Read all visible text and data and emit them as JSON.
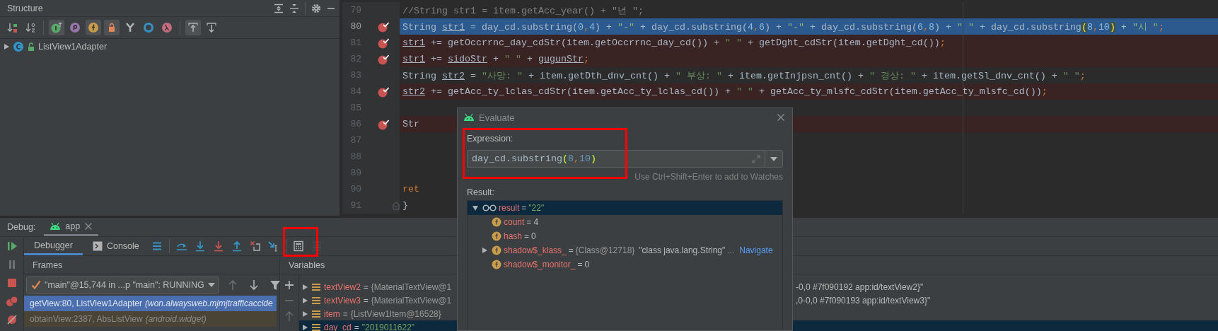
{
  "structure_panel": {
    "title": "Structure",
    "header_tools": [
      {
        "kind": "expand-all"
      },
      {
        "kind": "collapse-all"
      },
      {
        "kind": "gear"
      },
      {
        "kind": "minimize"
      }
    ],
    "toolbar": [
      {
        "kind": "sort-visibility",
        "on": false
      },
      {
        "kind": "sort-alpha",
        "on": false
      },
      {
        "kind": "inherited",
        "on": true
      },
      {
        "kind": "property",
        "on": false
      },
      {
        "kind": "field",
        "on": true
      },
      {
        "kind": "non-public",
        "on": true
      },
      {
        "kind": "anonymous",
        "on": false
      },
      {
        "kind": "circle",
        "on": false
      },
      {
        "kind": "lambda",
        "on": false
      },
      {
        "kind": "scroll-to",
        "on": true
      },
      {
        "kind": "scroll-from",
        "on": false
      }
    ],
    "tree": [
      {
        "label": "ListView1Adapter",
        "expanded": false
      }
    ]
  },
  "editor": {
    "lines": [
      {
        "number": "79",
        "breakpoint": false,
        "current": false,
        "tokens": [
          {
            "kind": "comment",
            "text": "       //String str1 = item.getAcc_year() + \"년 \";"
          }
        ]
      },
      {
        "number": "80",
        "breakpoint": true,
        "current": true,
        "tokens": [
          {
            "kind": "plain",
            "text": "       String "
          },
          {
            "kind": "var",
            "text": "str1"
          },
          {
            "kind": "plain",
            "text": " = day_cd.substring("
          },
          {
            "kind": "number",
            "text": "0"
          },
          {
            "kind": "punct",
            "text": ","
          },
          {
            "kind": "number",
            "text": "4"
          },
          {
            "kind": "plain",
            "text": ") + "
          },
          {
            "kind": "string",
            "text": "\"-\""
          },
          {
            "kind": "plain",
            "text": " + day_cd.substring("
          },
          {
            "kind": "number",
            "text": "4"
          },
          {
            "kind": "punct",
            "text": ","
          },
          {
            "kind": "number",
            "text": "6"
          },
          {
            "kind": "plain",
            "text": ") + "
          },
          {
            "kind": "string",
            "text": "\"-\""
          },
          {
            "kind": "plain",
            "text": " + day_cd.substring("
          },
          {
            "kind": "number",
            "text": "6"
          },
          {
            "kind": "punct",
            "text": ","
          },
          {
            "kind": "number",
            "text": "8"
          },
          {
            "kind": "plain",
            "text": ") + "
          },
          {
            "kind": "string",
            "text": "\" \""
          },
          {
            "kind": "plain",
            "text": " + day_cd.substring"
          },
          {
            "kind": "brace",
            "text": "("
          },
          {
            "kind": "number",
            "text": "8"
          },
          {
            "kind": "punct",
            "text": ","
          },
          {
            "kind": "number",
            "text": "10"
          },
          {
            "kind": "brace",
            "text": ")"
          },
          {
            "kind": "plain",
            "text": " + "
          },
          {
            "kind": "string",
            "text": "\"시 \""
          },
          {
            "kind": "punct",
            "text": ";"
          }
        ]
      },
      {
        "number": "81",
        "breakpoint": true,
        "current": false,
        "tokens": [
          {
            "kind": "var",
            "text": "              str1"
          },
          {
            "kind": "plain",
            "text": " += getOccrrnc_day_cdStr(item.getOccrrnc_day_cd()) + "
          },
          {
            "kind": "string",
            "text": "\" \""
          },
          {
            "kind": "plain",
            "text": " + getDght_cdStr(item.getDght_cd())"
          },
          {
            "kind": "punct",
            "text": ";"
          }
        ]
      },
      {
        "number": "82",
        "breakpoint": true,
        "current": false,
        "tokens": [
          {
            "kind": "var",
            "text": "              str1"
          },
          {
            "kind": "plain",
            "text": " += "
          },
          {
            "kind": "var",
            "text": "sidoStr"
          },
          {
            "kind": "plain",
            "text": " + "
          },
          {
            "kind": "string",
            "text": "\" \""
          },
          {
            "kind": "plain",
            "text": " + "
          },
          {
            "kind": "var",
            "text": "gugunStr"
          },
          {
            "kind": "punct",
            "text": ";"
          }
        ]
      },
      {
        "number": "83",
        "breakpoint": false,
        "current": false,
        "tokens": [
          {
            "kind": "plain",
            "text": "       String "
          },
          {
            "kind": "var",
            "text": "str2"
          },
          {
            "kind": "plain",
            "text": " = "
          },
          {
            "kind": "string",
            "text": "\"사망: \""
          },
          {
            "kind": "plain",
            "text": " + item.getDth_dnv_cnt() + "
          },
          {
            "kind": "string",
            "text": "\" 부상: \""
          },
          {
            "kind": "plain",
            "text": " + item.getInjpsn_cnt() + "
          },
          {
            "kind": "string",
            "text": "\" 경상: \""
          },
          {
            "kind": "plain",
            "text": " + item.getSl_dnv_cnt() + "
          },
          {
            "kind": "string",
            "text": "\" \""
          },
          {
            "kind": "punct",
            "text": ";"
          }
        ]
      },
      {
        "number": "84",
        "breakpoint": true,
        "current": false,
        "tokens": [
          {
            "kind": "var",
            "text": "              str2"
          },
          {
            "kind": "plain",
            "text": " += getAcc_ty_lclas_cdStr(item.getAcc_ty_lclas_cd()) + "
          },
          {
            "kind": "string",
            "text": "\" \""
          },
          {
            "kind": "plain",
            "text": " + getAcc_ty_mlsfc_cdStr(item.getAcc_ty_mlsfc_cd())"
          },
          {
            "kind": "punct",
            "text": ";"
          }
        ]
      },
      {
        "number": "85",
        "breakpoint": false,
        "current": false
      },
      {
        "number": "86",
        "breakpoint": true,
        "current": false,
        "tokens": [
          {
            "kind": "plain",
            "text": "       Str"
          }
        ]
      },
      {
        "number": "87",
        "breakpoint": false,
        "current": false
      },
      {
        "number": "88",
        "breakpoint": false,
        "current": false
      },
      {
        "number": "89",
        "breakpoint": false,
        "current": false
      },
      {
        "number": "90",
        "breakpoint": false,
        "current": false,
        "tokens": [
          {
            "kind": "keyword",
            "text": "       ret"
          }
        ]
      },
      {
        "number": "91",
        "breakpoint": false,
        "current": false,
        "fold": true,
        "tokens": [
          {
            "kind": "plain",
            "text": "   }"
          }
        ]
      }
    ]
  },
  "debug": {
    "label": "Debug:",
    "session_tab": {
      "label": "app",
      "selected": true
    },
    "side_tools": [
      {
        "kind": "resume",
        "disabled": false
      },
      {
        "kind": "pause",
        "disabled": true
      },
      {
        "kind": "stop",
        "disabled": false
      },
      {
        "kind": "breakpoints",
        "disabled": false
      },
      {
        "kind": "mute",
        "disabled": false
      }
    ],
    "tabs": [
      {
        "label": "Debugger",
        "selected": true,
        "kind": "plain"
      },
      {
        "label": "Console",
        "selected": false,
        "kind": "console"
      }
    ],
    "tools": [
      {
        "kind": "menu",
        "disabled": false
      },
      {
        "kind": "separator"
      },
      {
        "kind": "exec-point",
        "disabled": false
      },
      {
        "kind": "step-into",
        "disabled": false
      },
      {
        "kind": "force-step-into",
        "disabled": false
      },
      {
        "kind": "step-out",
        "disabled": false
      },
      {
        "kind": "drop-frame",
        "disabled": false
      },
      {
        "kind": "run-cursor",
        "disabled": false
      },
      {
        "kind": "separator"
      },
      {
        "kind": "calculator",
        "disabled": false,
        "annotated": true
      },
      {
        "kind": "trace",
        "disabled": true
      }
    ],
    "frames": {
      "title": "Frames",
      "thread": "\"main\"@15,744 in ...p \"main\": RUNNING",
      "nav": [
        {
          "kind": "up",
          "disabled": true
        },
        {
          "kind": "down",
          "disabled": false
        },
        {
          "kind": "filter",
          "disabled": false
        }
      ],
      "rows": [
        {
          "method": "getView:80, ListView1Adapter",
          "package": "(won.alwaysweb.mjmjtrafficaccide",
          "selected": true,
          "kind": "app"
        },
        {
          "method": "obtainView:2387, AbsListView",
          "package": "(android.widget)",
          "selected": false,
          "kind": "library"
        }
      ]
    },
    "variables": {
      "title": "Variables",
      "tools": [
        {
          "kind": "plus",
          "disabled": false
        },
        {
          "kind": "minus",
          "disabled": true
        },
        {
          "kind": "up",
          "disabled": true
        }
      ],
      "rows": [
        {
          "name": "textView2",
          "op": "=",
          "value": "{MaterialTextView@1",
          "tail": "-0,0 #7f090192 app:id/textView2}\"",
          "kind": "object",
          "selected": false
        },
        {
          "name": "textView3",
          "op": "=",
          "value": "{MaterialTextView@1",
          "tail": ",0-0,0 #7f090193 app:id/textView3}\"",
          "kind": "object",
          "selected": false
        },
        {
          "name": "item",
          "op": "=",
          "value": "{ListView1Item@16528}",
          "kind": "object",
          "selected": false
        },
        {
          "name": "day_cd",
          "op": "=",
          "value": "\"2019011622\"",
          "kind": "string",
          "selected": true
        }
      ]
    }
  },
  "evaluate_dialog": {
    "title": "Evaluate",
    "expression_label": "Expression:",
    "annotated": true,
    "expression": [
      {
        "kind": "plain",
        "text": "day_cd.substring"
      },
      {
        "kind": "brace",
        "text": "("
      },
      {
        "kind": "number",
        "text": "8"
      },
      {
        "kind": "punct",
        "text": ","
      },
      {
        "kind": "number",
        "text": "10"
      },
      {
        "kind": "brace",
        "text": ")"
      }
    ],
    "hint": "Use Ctrl+Shift+Enter to add to Watches",
    "result_label": "Result:",
    "result": {
      "name": "result",
      "op": "=",
      "value": "\"22\"",
      "kind": "string",
      "expanded": true,
      "selected": true,
      "children": [
        {
          "name": "count",
          "op": "=",
          "value": "4",
          "kind": "plain",
          "has_children": false
        },
        {
          "name": "hash",
          "op": "=",
          "value": "0",
          "kind": "plain",
          "has_children": false
        },
        {
          "name": "shadow$_klass_",
          "op": "=",
          "value": "{Class@12718}",
          "detail": "\"class java.lang.String\"",
          "ellipsis": "...",
          "link": "Navigate",
          "kind": "object",
          "has_children": true,
          "expanded": false
        },
        {
          "name": "shadow$_monitor_",
          "op": "=",
          "value": "0",
          "kind": "plain",
          "has_children": false
        }
      ]
    }
  }
}
